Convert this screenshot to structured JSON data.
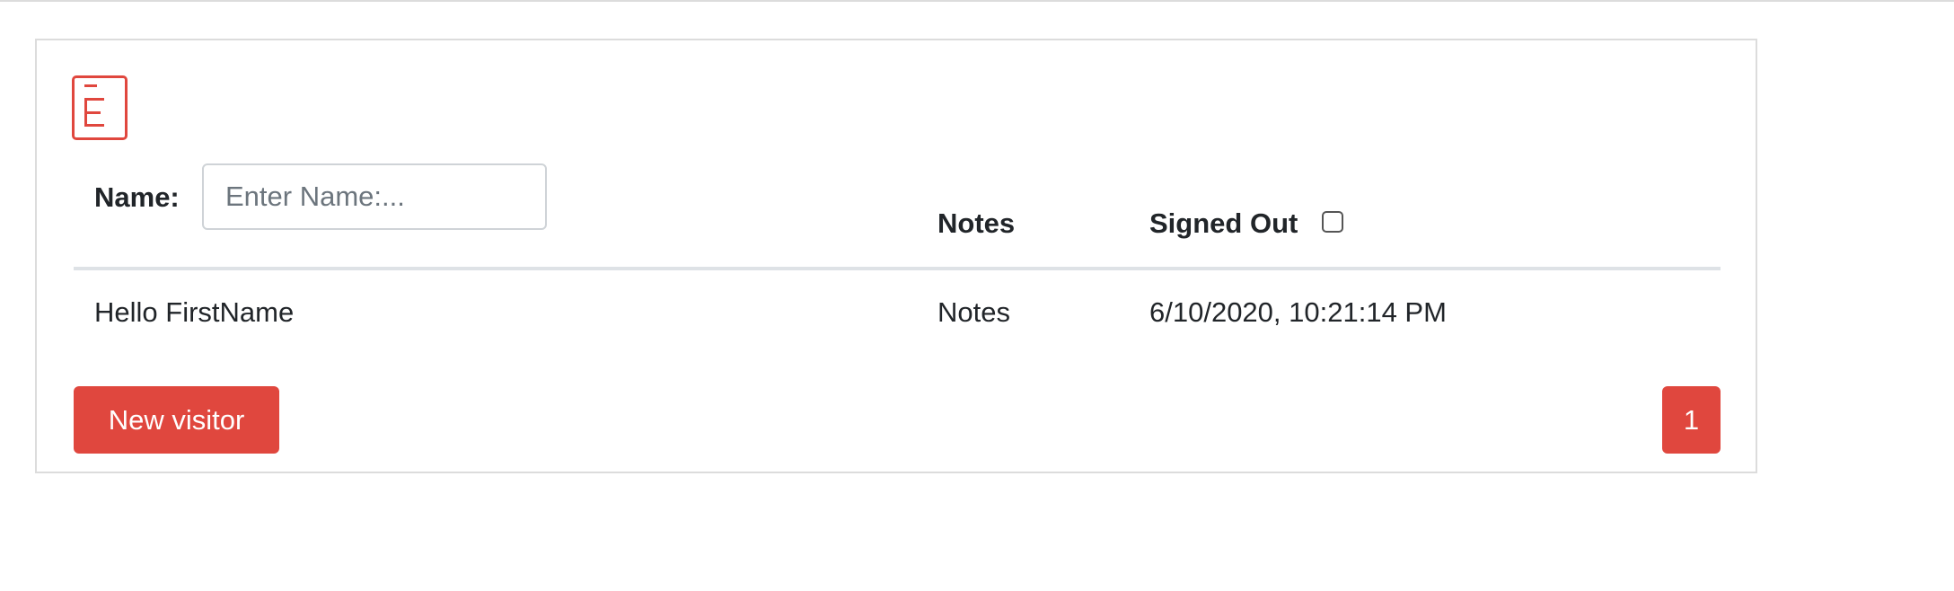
{
  "logo": {
    "icon": "document-e-icon",
    "color": "#e0473e"
  },
  "filter": {
    "name_label": "Name:",
    "name_placeholder": "Enter Name:...",
    "name_value": ""
  },
  "table": {
    "columns": {
      "notes": "Notes",
      "signed_out": "Signed Out"
    },
    "signed_out_filter_checked": false,
    "rows": [
      {
        "name": "Hello FirstName",
        "notes": "Notes",
        "signed_out": "6/10/2020, 10:21:14 PM"
      }
    ]
  },
  "actions": {
    "new_visitor_label": "New visitor"
  },
  "pagination": {
    "current_page": "1"
  },
  "colors": {
    "accent": "#e0473e",
    "border": "#dcdcdc",
    "text": "#212529",
    "placeholder": "#6c757d"
  }
}
